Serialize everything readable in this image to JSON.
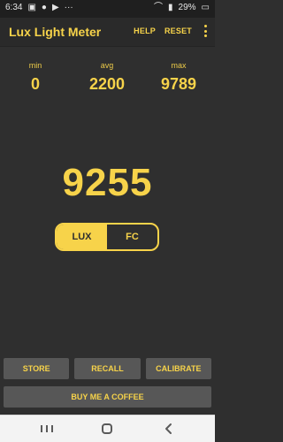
{
  "status": {
    "time": "6:34",
    "battery": "29%",
    "icons_left": [
      "image-icon",
      "mic-icon",
      "youtube-icon",
      "more-notifications-icon"
    ],
    "icons_right": [
      "wifi-icon",
      "signal-icon",
      "battery-icon"
    ]
  },
  "app_bar": {
    "title": "Lux Light Meter",
    "help_label": "HELP",
    "reset_label": "RESET",
    "overflow_icon": "overflow-menu-icon"
  },
  "stats": {
    "min_label": "min",
    "min_value": "0",
    "avg_label": "avg",
    "avg_value": "2200",
    "max_label": "max",
    "max_value": "9789"
  },
  "reading": {
    "value": "9255"
  },
  "unit_toggle": {
    "lux_label": "LUX",
    "fc_label": "FC",
    "selected": "LUX"
  },
  "buttons": {
    "store_label": "STORE",
    "recall_label": "RECALL",
    "calibrate_label": "CALIBRATE",
    "coffee_label": "BUY ME A COFFEE"
  },
  "nav": {
    "recents_icon": "recents-icon",
    "home_icon": "home-icon",
    "back_icon": "back-icon"
  },
  "colors": {
    "accent": "#f7d34a",
    "background": "#2f2f2f",
    "button_bg": "#575757"
  }
}
